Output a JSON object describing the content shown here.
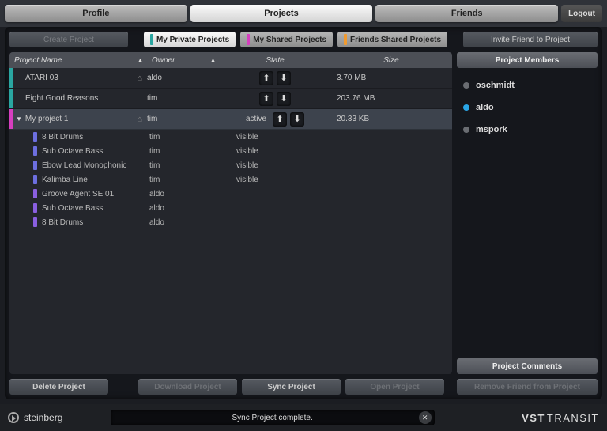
{
  "tabs": {
    "profile": "Profile",
    "projects": "Projects",
    "friends": "Friends",
    "logout": "Logout"
  },
  "toolbar": {
    "create": "Create Project",
    "invite": "Invite Friend to Project",
    "filter_private": "My Private Projects",
    "filter_shared": "My Shared Projects",
    "filter_friends": "Friends Shared Projects"
  },
  "columns": {
    "name": "Project Name",
    "owner": "Owner",
    "state": "State",
    "size": "Size"
  },
  "projects": [
    {
      "name": "ATARI 03",
      "owner": "aldo",
      "state": "",
      "size": "3.70 MB",
      "accent": "#2aa6a1",
      "home": true,
      "selected": false
    },
    {
      "name": "Eight Good Reasons",
      "owner": "tim",
      "state": "",
      "size": "203.76 MB",
      "accent": "#2aa6a1",
      "home": false,
      "selected": false
    },
    {
      "name": "My project 1",
      "owner": "tim",
      "state": "active",
      "size": "20.33 KB",
      "accent": "#d63fbf",
      "home": true,
      "selected": true
    }
  ],
  "tracks": [
    {
      "name": "8 Bit Drums",
      "owner": "tim",
      "state": "visible",
      "color": "#6d6fe0"
    },
    {
      "name": "Sub Octave Bass",
      "owner": "tim",
      "state": "visible",
      "color": "#6d6fe0"
    },
    {
      "name": "Ebow Lead Monophonic",
      "owner": "tim",
      "state": "visible",
      "color": "#6d6fe0"
    },
    {
      "name": "Kalimba Line",
      "owner": "tim",
      "state": "visible",
      "color": "#6d6fe0"
    },
    {
      "name": "Groove Agent SE 01",
      "owner": "aldo",
      "state": "",
      "color": "#8a5fe0"
    },
    {
      "name": "Sub Octave Bass",
      "owner": "aldo",
      "state": "",
      "color": "#8a5fe0"
    },
    {
      "name": "8 Bit Drums",
      "owner": "aldo",
      "state": "",
      "color": "#8a5fe0"
    }
  ],
  "sidebar": {
    "members_header": "Project Members",
    "comments_header": "Project Comments",
    "members": [
      {
        "name": "oschmidt",
        "color": "#6a6d72"
      },
      {
        "name": "aldo",
        "color": "#2aa6e6"
      },
      {
        "name": "mspork",
        "color": "#6a6d72"
      }
    ]
  },
  "actions": {
    "delete": "Delete Project",
    "download": "Download Project",
    "sync": "Sync Project",
    "open": "Open Project",
    "remove_friend": "Remove Friend from Project"
  },
  "footer": {
    "brand_left": "steinberg",
    "status": "Sync Project complete.",
    "brand_right_1": "VST",
    "brand_right_2": "TRANSIT"
  },
  "colors": {
    "filter_private": "#2aa6a1",
    "filter_shared": "#d63fbf",
    "filter_friends": "#f29a2e"
  }
}
